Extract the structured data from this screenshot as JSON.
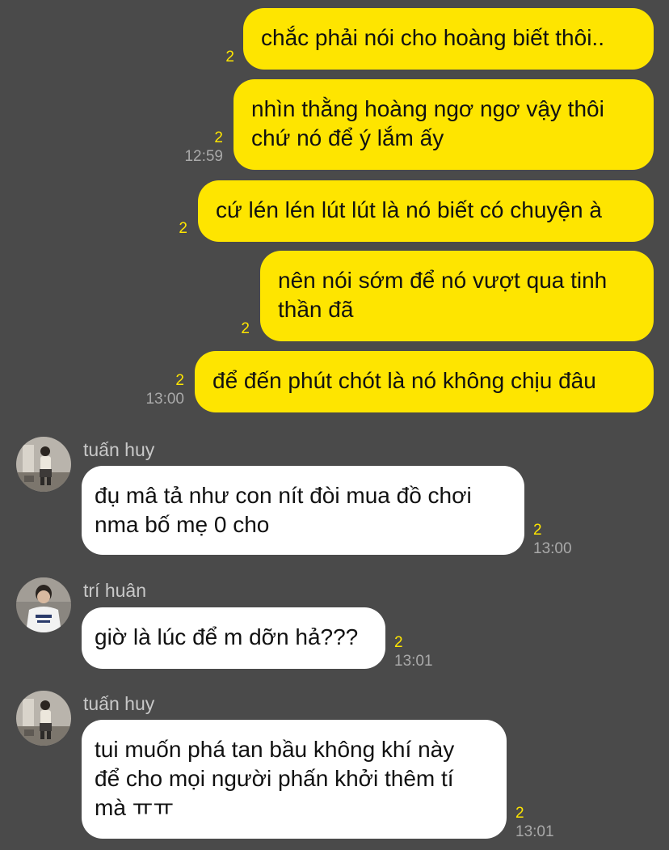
{
  "colors": {
    "background": "#4a4a4a",
    "my_bubble": "#fee500",
    "their_bubble": "#ffffff",
    "read_count": "#fee500",
    "timestamp": "#a9a9a9",
    "sender_name": "#c8c8c8"
  },
  "outgoing": [
    {
      "text": "chắc phải nói cho hoàng biết thôi..",
      "count": "2",
      "time": ""
    },
    {
      "text": "nhìn thằng hoàng ngơ ngơ vậy thôi\nchứ nó để ý lắm ấy",
      "count": "2",
      "time": "12:59"
    },
    {
      "text": "cứ lén lén lút lút là nó biết có chuyện à",
      "count": "2",
      "time": ""
    },
    {
      "text": "nên nói sớm để nó vượt qua tinh\nthần đã",
      "count": "2",
      "time": ""
    },
    {
      "text": "để đến phút chót là nó không chịu đâu",
      "count": "2",
      "time": "13:00"
    }
  ],
  "incoming": [
    {
      "sender": "tuấn huy",
      "text": "đụ mâ tả như con nít đòi mua đồ chơi\nnma bố mẹ 0 cho",
      "count": "2",
      "time": "13:00",
      "avatar_icon": "avatar-tuan-huy-icon"
    },
    {
      "sender": "trí huân",
      "text": "giờ là lúc để m dỡn hả???",
      "count": "2",
      "time": "13:01",
      "avatar_icon": "avatar-tri-huan-icon"
    },
    {
      "sender": "tuấn huy",
      "text": "tui muốn phá tan bầu không khí này\nđể cho mọi người phấn khởi thêm tí\nmà ㅠㅠ",
      "count": "2",
      "time": "13:01",
      "avatar_icon": "avatar-tuan-huy-icon"
    }
  ]
}
